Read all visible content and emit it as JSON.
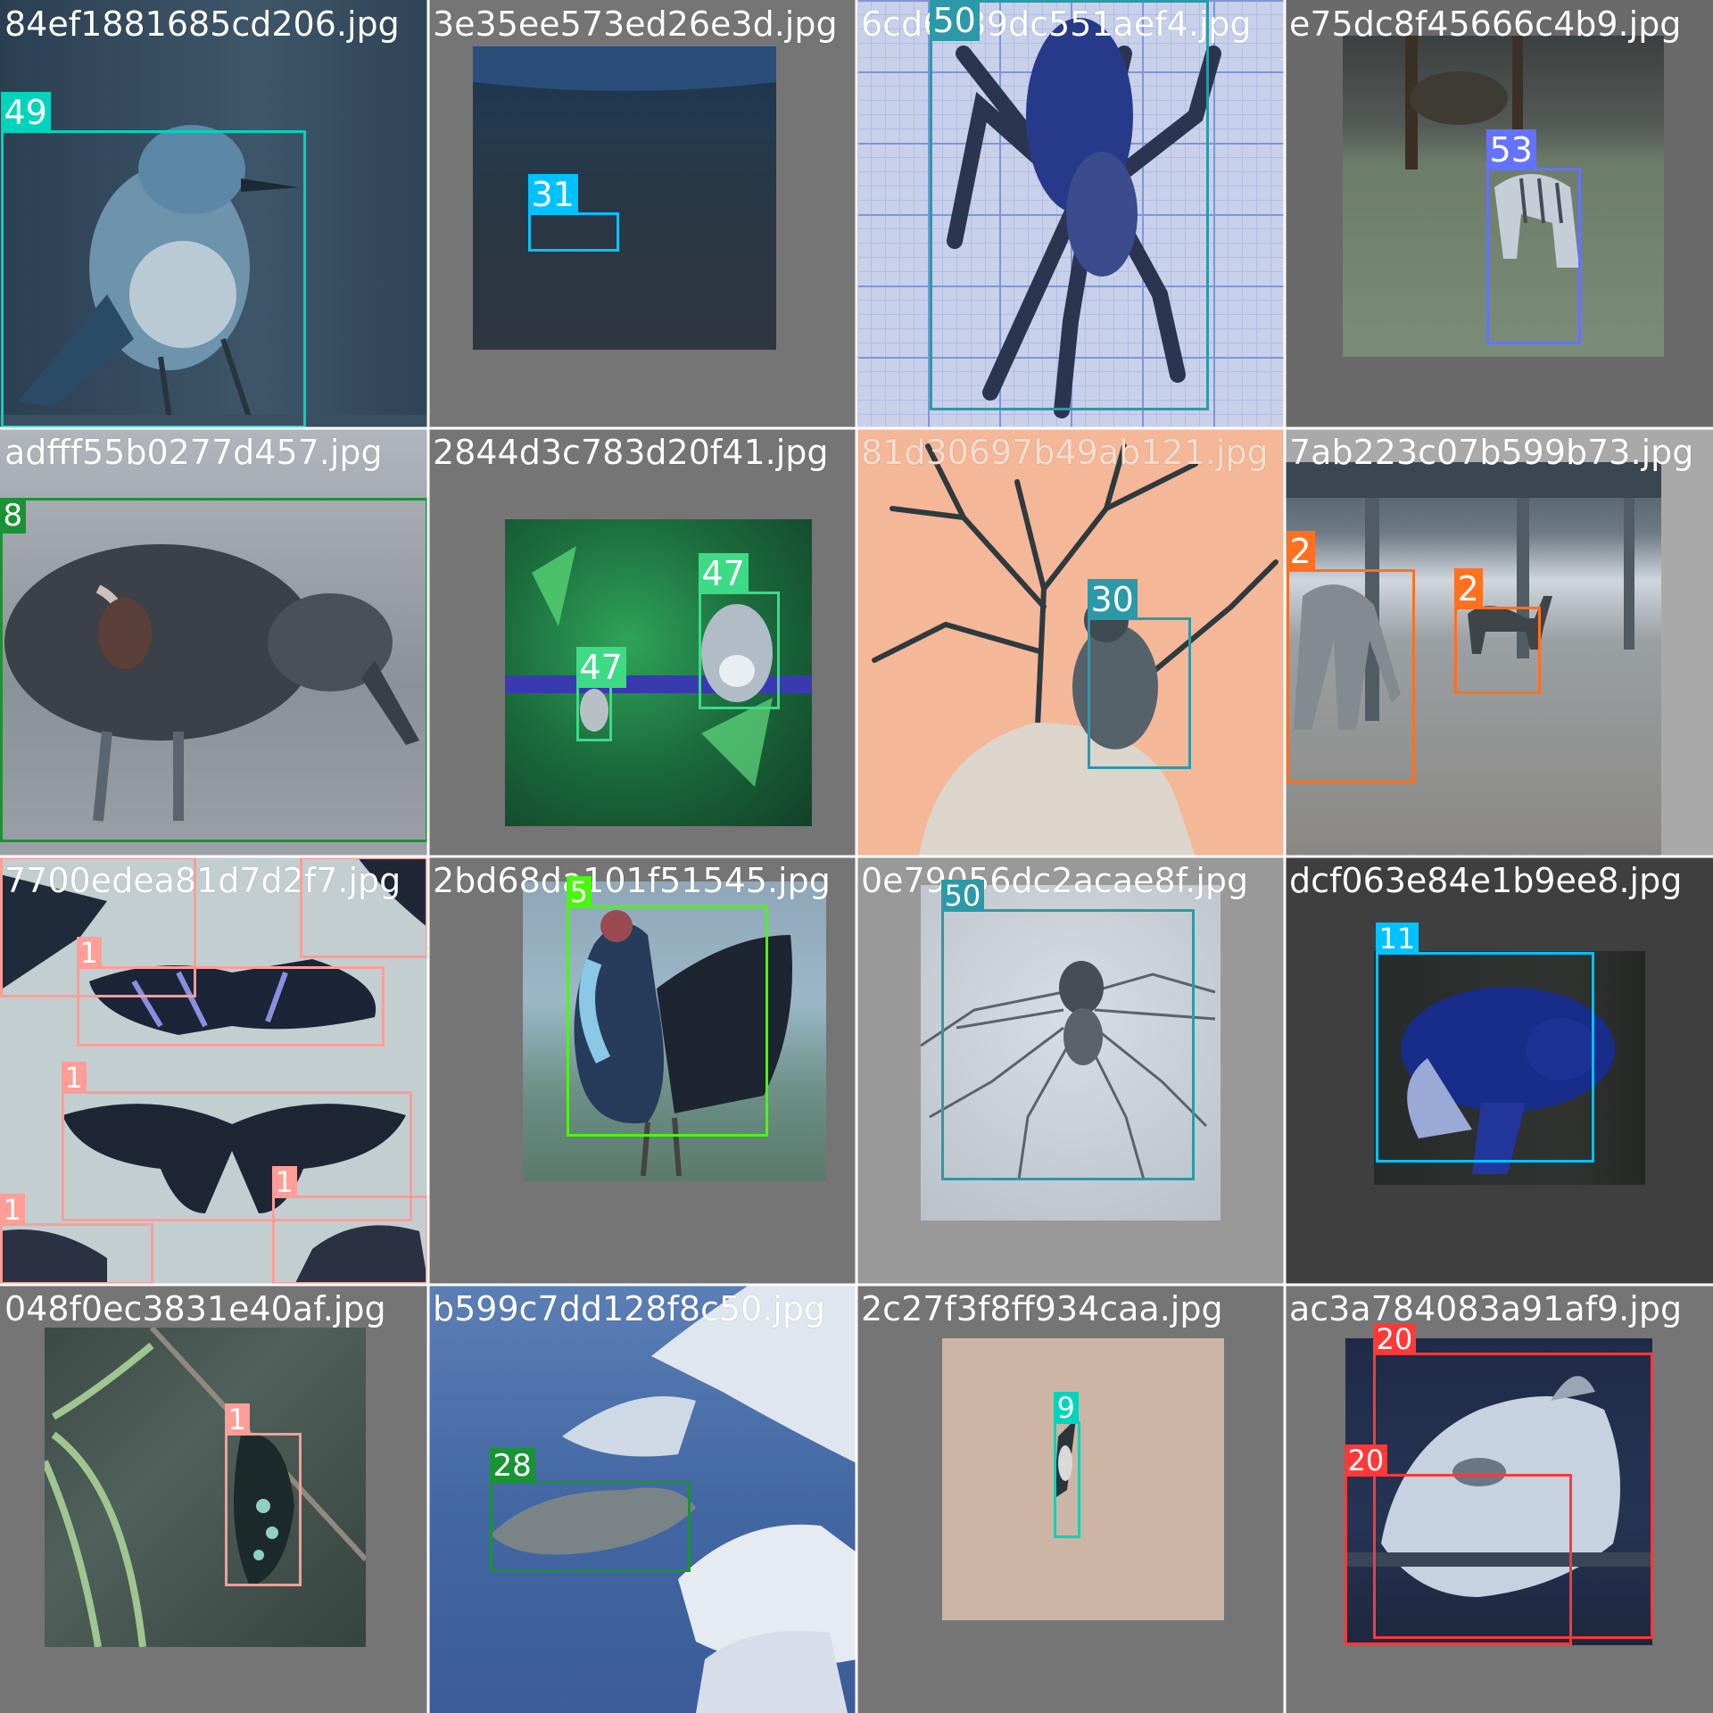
{
  "tiles": [
    {
      "filename": "84ef1881685cd206.jpg",
      "labels": [
        "49"
      ]
    },
    {
      "filename": "3e35ee573ed26e3d.jpg",
      "labels": [
        "31"
      ]
    },
    {
      "filename": "6cd6a39dc551aef4.jpg",
      "labels": [
        "50"
      ]
    },
    {
      "filename": "e75dc8f45666c4b9.jpg",
      "labels": [
        "53"
      ]
    },
    {
      "filename": "adfff55b0277d457.jpg",
      "labels": [
        "8"
      ]
    },
    {
      "filename": "2844d3c783d20f41.jpg",
      "labels": [
        "47",
        "47"
      ]
    },
    {
      "filename": "81d30697b49ab121.jpg",
      "labels": [
        "30"
      ]
    },
    {
      "filename": "7ab223c07b599b73.jpg",
      "labels": [
        "2",
        "2"
      ]
    },
    {
      "filename": "7700edea81d7d2f7.jpg",
      "labels": [
        "1",
        "1",
        "1",
        "1",
        "1",
        "1"
      ]
    },
    {
      "filename": "2bd68da101f51545.jpg",
      "labels": [
        "5"
      ]
    },
    {
      "filename": "0e79056dc2acae8f.jpg",
      "labels": [
        "50"
      ]
    },
    {
      "filename": "dcf063e84e1b9ee8.jpg",
      "labels": [
        "11"
      ]
    },
    {
      "filename": "048f0ec3831e40af.jpg",
      "labels": [
        "1"
      ]
    },
    {
      "filename": "b599c7dd128f8c50.jpg",
      "labels": [
        "28"
      ]
    },
    {
      "filename": "2c27f3f8ff934caa.jpg",
      "labels": [
        "9"
      ]
    },
    {
      "filename": "ac3a784083a91af9.jpg",
      "labels": [
        "20",
        "20"
      ]
    }
  ],
  "class_colors": {
    "1": "#ff9d97",
    "2": "#ff701f",
    "5": "#48f90a",
    "8": "#1a9334",
    "9": "#00d4bb",
    "11": "#00c2ff",
    "20": "#ff3838",
    "28": "#1a9334",
    "30": "#2c99a8",
    "31": "#00c2ff",
    "47": "#3ddb86",
    "49": "#00d4bb",
    "50": "#2c99a8",
    "53": "#6473ff"
  }
}
